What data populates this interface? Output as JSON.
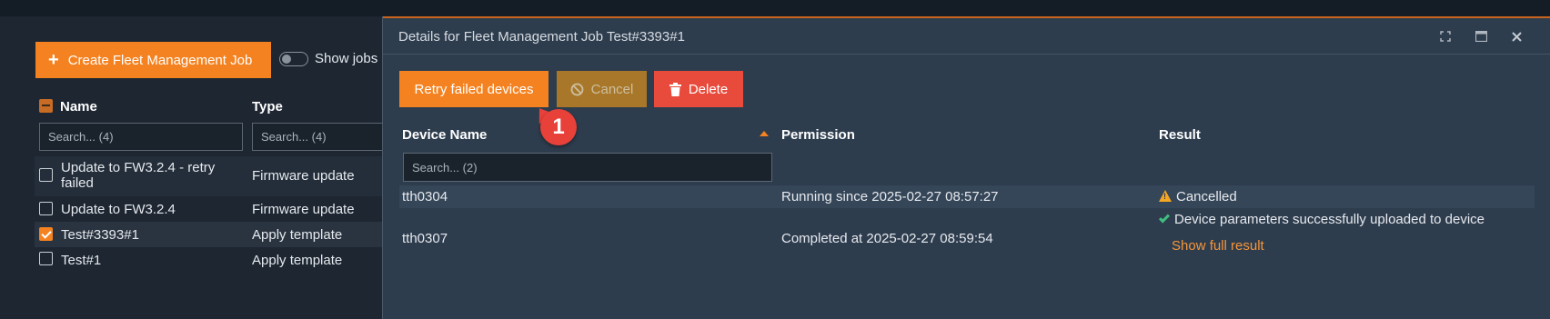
{
  "jobs_panel": {
    "create_button_label": "Create Fleet Management Job",
    "show_jobs_label": "Show jobs",
    "columns": {
      "name": "Name",
      "type": "Type"
    },
    "search_name_placeholder": "Search... (4)",
    "search_type_placeholder": "Search... (4)",
    "rows": [
      {
        "name": "Update to FW3.2.4 - retry failed",
        "type": "Firmware update",
        "checked": false
      },
      {
        "name": "Update to FW3.2.4",
        "type": "Firmware update",
        "checked": false
      },
      {
        "name": "Test#3393#1",
        "type": "Apply template",
        "checked": true
      },
      {
        "name": "Test#1",
        "type": "Apply template",
        "checked": false
      }
    ]
  },
  "dialog": {
    "title": "Details for Fleet Management Job Test#3393#1",
    "retry_label": "Retry failed devices",
    "cancel_label": "Cancel",
    "delete_label": "Delete",
    "badge": "1",
    "columns": {
      "device": "Device Name",
      "permission": "Permission",
      "result": "Result"
    },
    "search_placeholder": "Search... (2)",
    "rows": [
      {
        "device": "tth0304",
        "permission": "Running since 2025-02-27 08:57:27",
        "result": "Cancelled",
        "result_icon": "warning-icon"
      },
      {
        "device": "tth0307",
        "permission": "Completed at 2025-02-27 08:59:54",
        "result": "Device parameters successfully uploaded to device",
        "result_icon": "check-icon",
        "link": "Show full result"
      }
    ]
  },
  "colors": {
    "accent": "#f58220",
    "danger": "#e84b3c",
    "success": "#3fbf7f",
    "warning": "#f5a623"
  }
}
